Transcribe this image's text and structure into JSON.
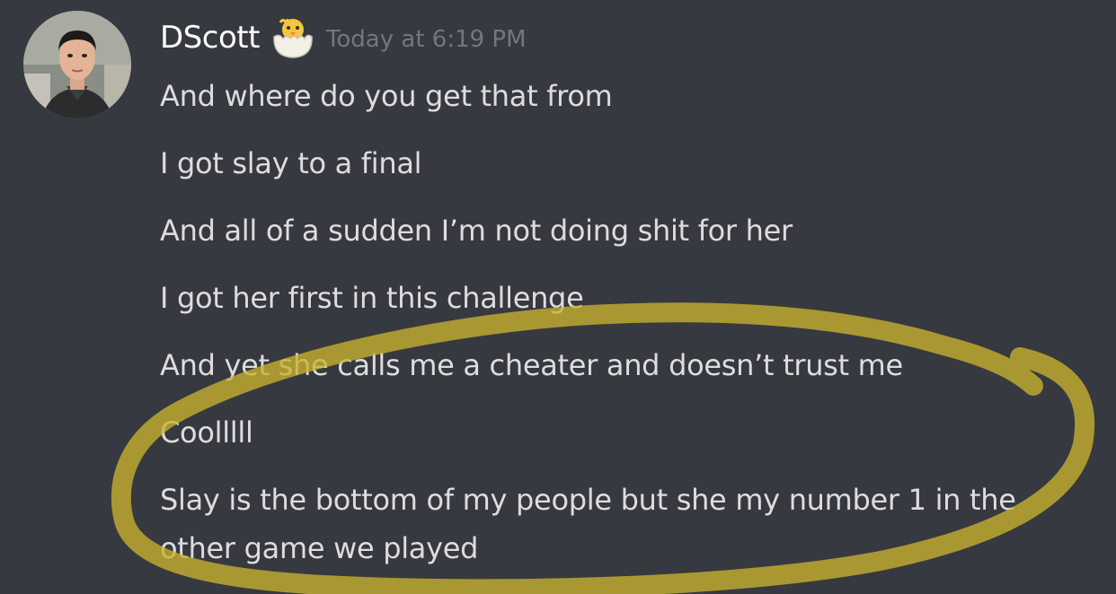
{
  "author": {
    "username": "DScott",
    "badge_icon": "hatching-chick-icon",
    "timestamp": "Today at 6:19 PM"
  },
  "messages": [
    "And where do you get that from",
    "I got slay to a final",
    "And all of a sudden I’m not doing shit for her",
    "I got her first in this challenge",
    "And yet she calls me a cheater and doesn’t trust me",
    "Coolllll",
    "Slay is the bottom of my people but she my number 1 in the other game we played"
  ],
  "colors": {
    "background": "#36393f",
    "username": "#ffffff",
    "message_text": "#dcddde",
    "timestamp": "#72767d",
    "highlight_marker": "#c9b22e"
  }
}
